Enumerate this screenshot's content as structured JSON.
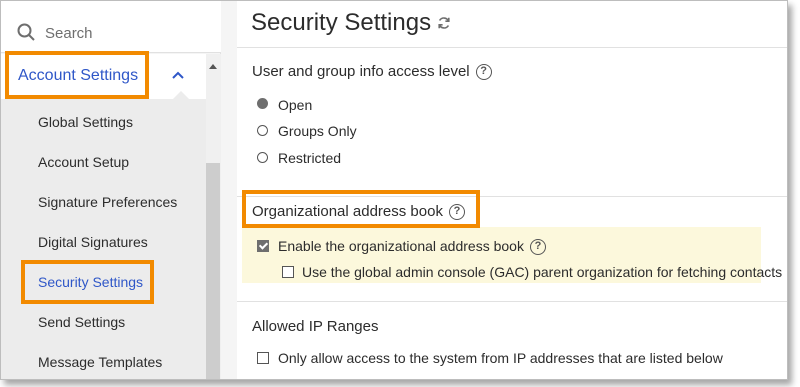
{
  "sidebar": {
    "search_placeholder": "Search",
    "section_label": "Account Settings",
    "items": [
      {
        "label": "Global Settings"
      },
      {
        "label": "Account Setup"
      },
      {
        "label": "Signature Preferences"
      },
      {
        "label": "Digital Signatures"
      },
      {
        "label": "Security Settings",
        "active": true
      },
      {
        "label": "Send Settings"
      },
      {
        "label": "Message Templates"
      }
    ]
  },
  "main": {
    "title": "Security Settings",
    "access": {
      "heading": "User and group info access level",
      "options": [
        {
          "label": "Open",
          "selected": true
        },
        {
          "label": "Groups Only",
          "selected": false
        },
        {
          "label": "Restricted",
          "selected": false
        }
      ]
    },
    "address_book": {
      "heading": "Organizational address book",
      "enable_label": "Enable the organizational address book",
      "enable_checked": true,
      "gac_label": "Use the global admin console (GAC) parent organization for fetching contacts",
      "gac_checked": false
    },
    "ip_ranges": {
      "heading": "Allowed IP Ranges",
      "restrict_label": "Only allow access to the system from IP addresses that are listed below",
      "restrict_checked": false
    }
  },
  "colors": {
    "callout": "#f28a00",
    "link_blue": "#2f57c8",
    "highlight": "#fcf8dc"
  }
}
